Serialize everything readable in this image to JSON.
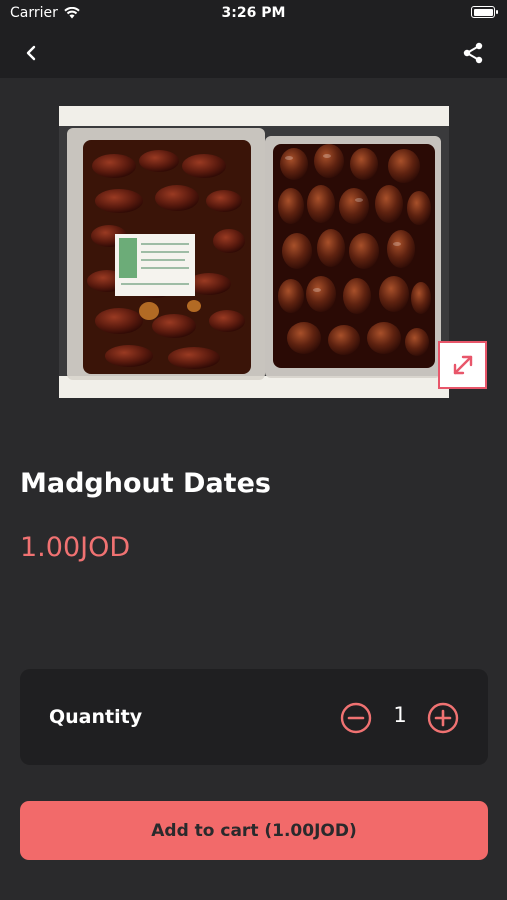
{
  "status_bar": {
    "carrier": "Carrier",
    "time": "3:26 PM"
  },
  "nav": {
    "back_icon": "chevron-left-icon",
    "share_icon": "share-icon"
  },
  "product": {
    "title": "Madghout Dates",
    "price": "1.00JOD",
    "image_icon": "product-photo",
    "expand_icon": "expand-icon"
  },
  "quantity": {
    "label": "Quantity",
    "value": "1",
    "minus_icon": "minus-circle-icon",
    "plus_icon": "plus-circle-icon"
  },
  "cart": {
    "button_label": "Add to cart (1.00JOD)"
  },
  "colors": {
    "background": "#2a2a2c",
    "bar": "#1f1f21",
    "accent": "#f26a6a",
    "price": "#f07272"
  }
}
